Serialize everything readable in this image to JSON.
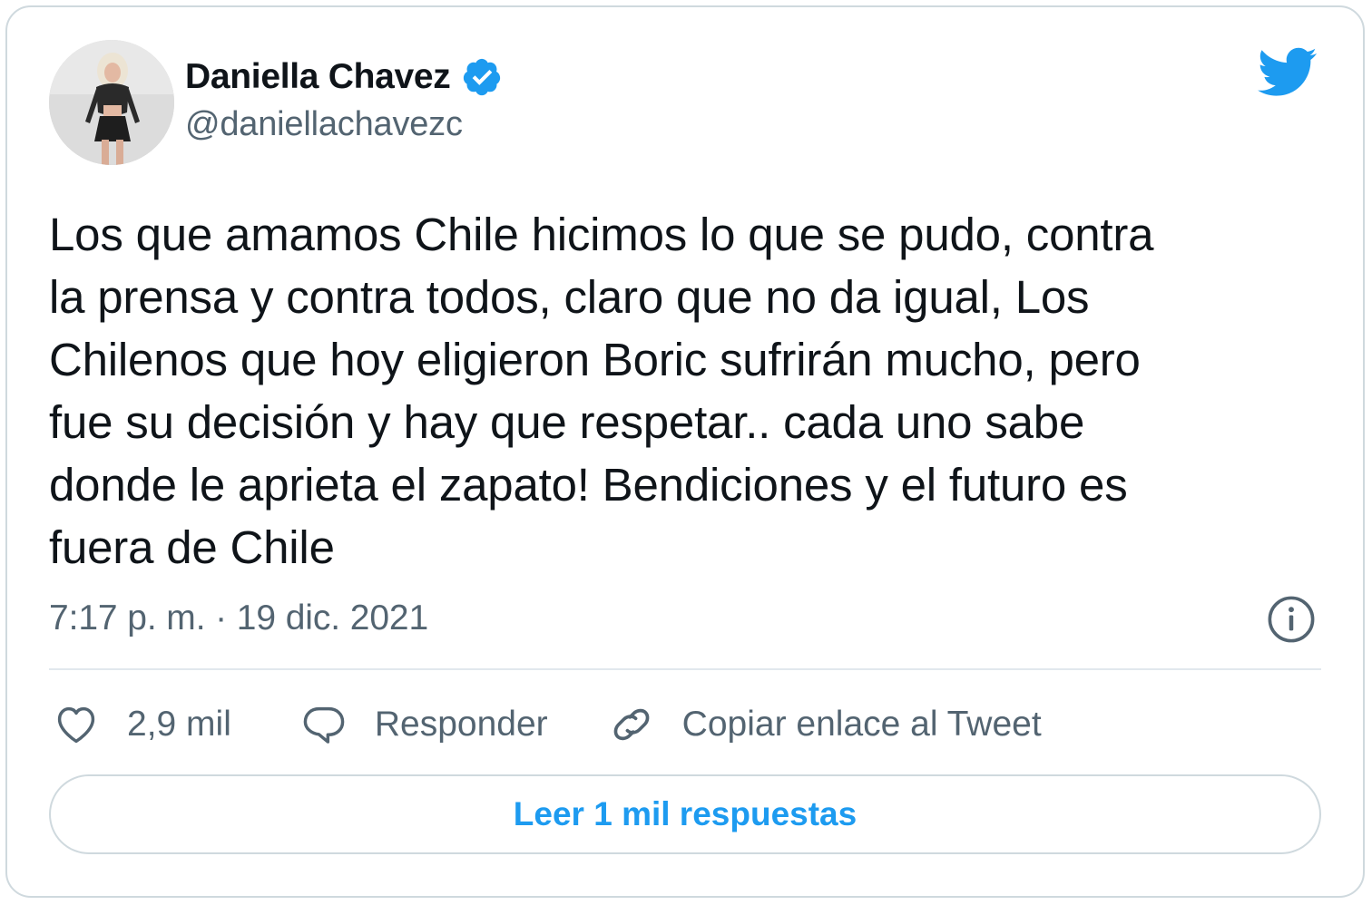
{
  "author": {
    "name": "Daniella Chavez",
    "handle": "@daniellachavezc",
    "verified": true
  },
  "tweet": {
    "text": "Los que amamos Chile hicimos lo que se pudo, contra\nla prensa y contra todos, claro que no da igual, Los\nChilenos que hoy eligieron Boric sufrirán mucho, pero\nfue su decisión y hay que respetar.. cada uno sabe\ndonde le aprieta el zapato! Bendiciones y el futuro es\nfuera de Chile",
    "timestamp": "7:17 p. m. · 19 dic. 2021"
  },
  "actions": {
    "likes_label": "2,9 mil",
    "reply_label": "Responder",
    "copy_link_label": "Copiar enlace al Tweet"
  },
  "read_replies_label": "Leer 1 mil respuestas",
  "icons": {
    "brand": "twitter-bird-icon",
    "verified": "verified-badge-icon",
    "info": "info-icon",
    "like": "heart-icon",
    "reply": "speech-bubble-icon",
    "link": "link-icon"
  },
  "colors": {
    "accent": "#1d9bf0",
    "text_primary": "#0f1419",
    "text_secondary": "#536471",
    "border": "#cfd9de"
  }
}
